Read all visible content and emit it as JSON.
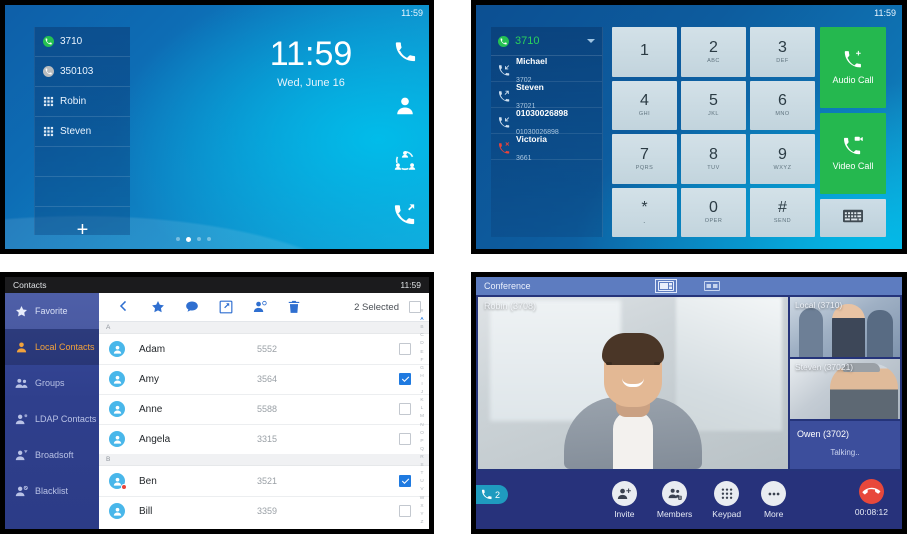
{
  "home": {
    "status_time": "11:59",
    "line_keys": [
      {
        "label": "3710",
        "icon": "phone-green-circle-icon"
      },
      {
        "label": "350103",
        "icon": "phone-gray-circle-icon"
      },
      {
        "label": "Robin",
        "icon": "keypad-grid-icon"
      },
      {
        "label": "Steven",
        "icon": "keypad-grid-icon"
      }
    ],
    "add_label": "+",
    "clock": "11:59",
    "date": "Wed, June 16",
    "rail_icons": [
      "phone-icon",
      "contacts-person-icon",
      "conference-icon",
      "call-history-icon"
    ],
    "page_dots": 4,
    "active_dot": 2
  },
  "dialer": {
    "status_time": "11:59",
    "account": "3710",
    "history": [
      {
        "name": "Michael",
        "number": "3702",
        "type": "incoming"
      },
      {
        "name": "Steven",
        "number": "37021",
        "type": "outgoing"
      },
      {
        "name": "01030026898",
        "number": "01030026898",
        "type": "incoming"
      },
      {
        "name": "Victoria",
        "number": "3661",
        "type": "missed"
      }
    ],
    "keys": [
      {
        "digit": "1",
        "sub": ""
      },
      {
        "digit": "2",
        "sub": "ABC"
      },
      {
        "digit": "3",
        "sub": "DEF"
      },
      {
        "digit": "4",
        "sub": "GHI"
      },
      {
        "digit": "5",
        "sub": "JKL"
      },
      {
        "digit": "6",
        "sub": "MNO"
      },
      {
        "digit": "7",
        "sub": "PQRS"
      },
      {
        "digit": "8",
        "sub": "TUV"
      },
      {
        "digit": "9",
        "sub": "WXYZ"
      },
      {
        "digit": "*",
        "sub": "."
      },
      {
        "digit": "0",
        "sub": "OPER"
      },
      {
        "digit": "#",
        "sub": "SEND"
      }
    ],
    "audio_call": "Audio Call",
    "video_call": "Video Call",
    "keyboard_icon": "keyboard-icon",
    "accent_green": "#25b84f"
  },
  "contacts": {
    "status_title": "Contacts",
    "status_time": "11:59",
    "sidebar": [
      {
        "label": "Favorite",
        "icon": "star-icon",
        "state": "hover"
      },
      {
        "label": "Local Contacts",
        "icon": "person-icon",
        "state": "selected"
      },
      {
        "label": "Groups",
        "icon": "people-group-icon",
        "state": ""
      },
      {
        "label": "LDAP Contacts",
        "icon": "person-ldap-icon",
        "state": ""
      },
      {
        "label": "Broadsoft",
        "icon": "person-broadsoft-icon",
        "state": ""
      },
      {
        "label": "Blacklist",
        "icon": "person-block-icon",
        "state": ""
      }
    ],
    "toolbar": {
      "icons": [
        "back-chevron-icon",
        "star-icon",
        "chat-bubble-icon",
        "export-icon",
        "add-contact-icon",
        "trash-icon"
      ],
      "selected_text": "2 Selected",
      "select_all_checked": false
    },
    "sections": [
      {
        "letter": "A",
        "rows": [
          {
            "name": "Adam",
            "number": "5552",
            "checked": false,
            "blocked": false
          },
          {
            "name": "Amy",
            "number": "3564",
            "checked": true,
            "blocked": false
          },
          {
            "name": "Anne",
            "number": "5588",
            "checked": false,
            "blocked": false
          },
          {
            "name": "Angela",
            "number": "3315",
            "checked": false,
            "blocked": false
          }
        ]
      },
      {
        "letter": "B",
        "rows": [
          {
            "name": "Ben",
            "number": "3521",
            "checked": true,
            "blocked": true
          },
          {
            "name": "Bill",
            "number": "3359",
            "checked": false,
            "blocked": false
          }
        ]
      }
    ],
    "alphabet": [
      "#",
      "A",
      "B",
      "C",
      "D",
      "E",
      "F",
      "G",
      "H",
      "I",
      "J",
      "K",
      "L",
      "M",
      "N",
      "O",
      "P",
      "Q",
      "R",
      "S",
      "T",
      "U",
      "V",
      "W",
      "X",
      "Y",
      "Z"
    ],
    "alphabet_active": "A",
    "accent_selected": "#f2a23c",
    "accent_checkbox": "#1f7ae0"
  },
  "conference": {
    "title": "Conference",
    "layout_icons": [
      "layout-picture-in-picture-icon",
      "layout-split-icon"
    ],
    "layout_selected": 0,
    "main_label": "Robin (3708)",
    "tiles": [
      {
        "label": "Local (3710)",
        "kind": "video"
      },
      {
        "label": "Steven (37021)",
        "kind": "video"
      },
      {
        "label": "Owen (3702)",
        "kind": "audio",
        "status": "Talking.."
      }
    ],
    "call_count": "2",
    "actions": [
      {
        "label": "Invite",
        "icon": "add-person-icon"
      },
      {
        "label": "Members",
        "icon": "members-icon"
      },
      {
        "label": "Keypad",
        "icon": "keypad-grid-icon"
      },
      {
        "label": "More",
        "icon": "more-dots-icon"
      }
    ],
    "end_call_icon": "end-call-icon",
    "timer": "00:08:12",
    "accent_end": "#e8483b"
  }
}
